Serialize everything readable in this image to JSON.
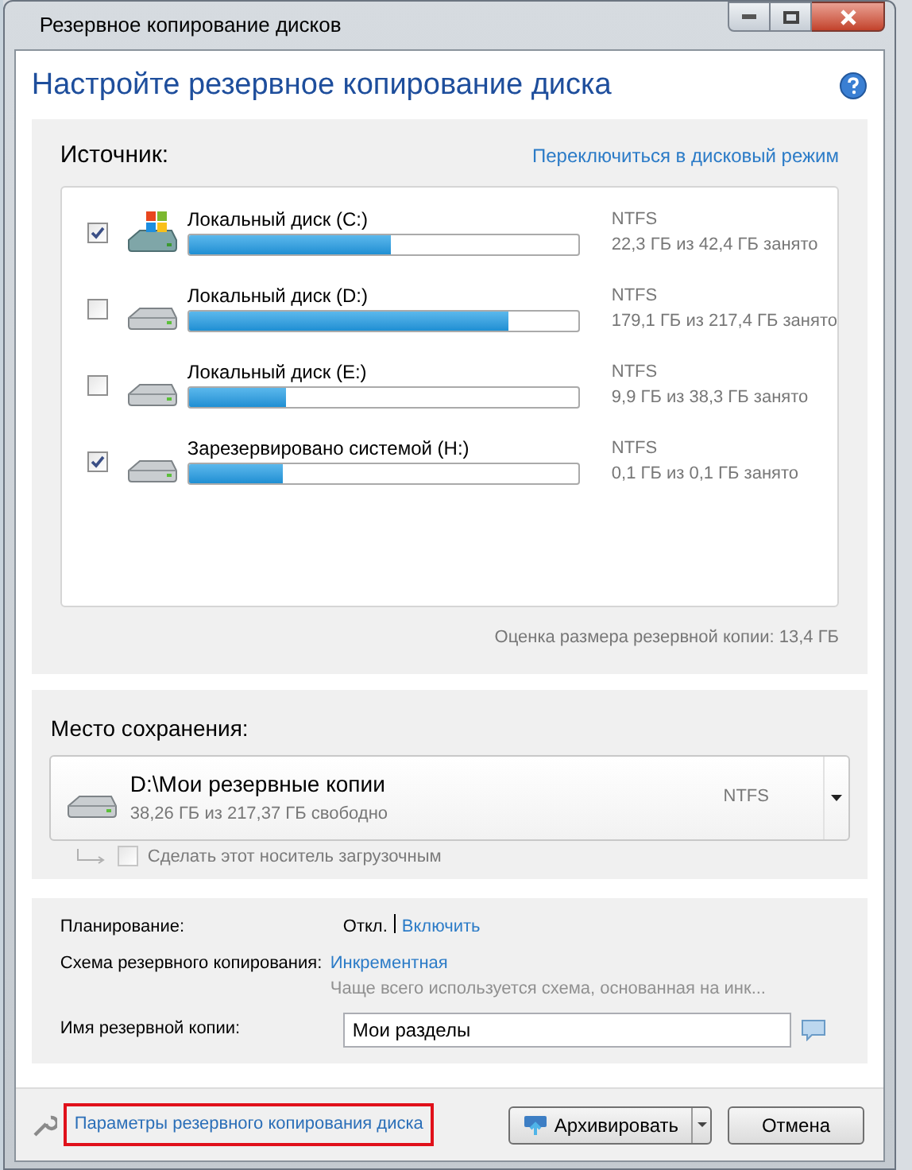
{
  "window": {
    "title": "Резервное копирование дисков"
  },
  "header": {
    "title": "Настройте резервное копирование диска"
  },
  "source": {
    "label": "Источник:",
    "mode_link": "Переключиться в дисковый режим",
    "disks": [
      {
        "name": "Локальный диск (C:)",
        "kind": "system",
        "checked": true,
        "level": 0.52,
        "fs": "NTFS",
        "usage": "22,3 ГБ из 42,4 ГБ занято"
      },
      {
        "name": "Локальный диск (D:)",
        "kind": "drive",
        "checked": false,
        "level": 0.82,
        "fs": "NTFS",
        "usage": "179,1 ГБ из 217,4 ГБ занято"
      },
      {
        "name": "Локальный диск (E:)",
        "kind": "drive",
        "checked": false,
        "level": 0.25,
        "fs": "NTFS",
        "usage": "9,9 ГБ из 38,3 ГБ занято"
      },
      {
        "name": "Зарезервировано системой (H:)",
        "kind": "drive",
        "checked": true,
        "level": 0.24,
        "fs": "NTFS",
        "usage": "0,1 ГБ из 0,1 ГБ занято"
      }
    ],
    "estimate": "Оценка размера резервной копии: 13,4 ГБ"
  },
  "destination": {
    "label": "Место сохранения:",
    "path": "D:\\Мои резервные копии",
    "free": "38,26 ГБ из 217,37 ГБ свободно",
    "fs": "NTFS",
    "bootable": {
      "label": "Сделать этот носитель загрузочным",
      "checked": false,
      "disabled": true
    }
  },
  "settings": {
    "schedule_label": "Планирование:",
    "schedule_value": "Откл.",
    "schedule_link": "Включить",
    "scheme_label": "Схема резервного копирования:",
    "scheme_link": "Инкрементная",
    "scheme_hint": "Чаще всего используется схема, основанная на инк...",
    "name_label": "Имя резервной копии:",
    "name_value": "Мои разделы"
  },
  "footer": {
    "options_link": {
      "label": "Параметры резервного копирования диска",
      "highlighted": true
    },
    "archive_button": "Архивировать",
    "cancel_button": "Отмена"
  }
}
